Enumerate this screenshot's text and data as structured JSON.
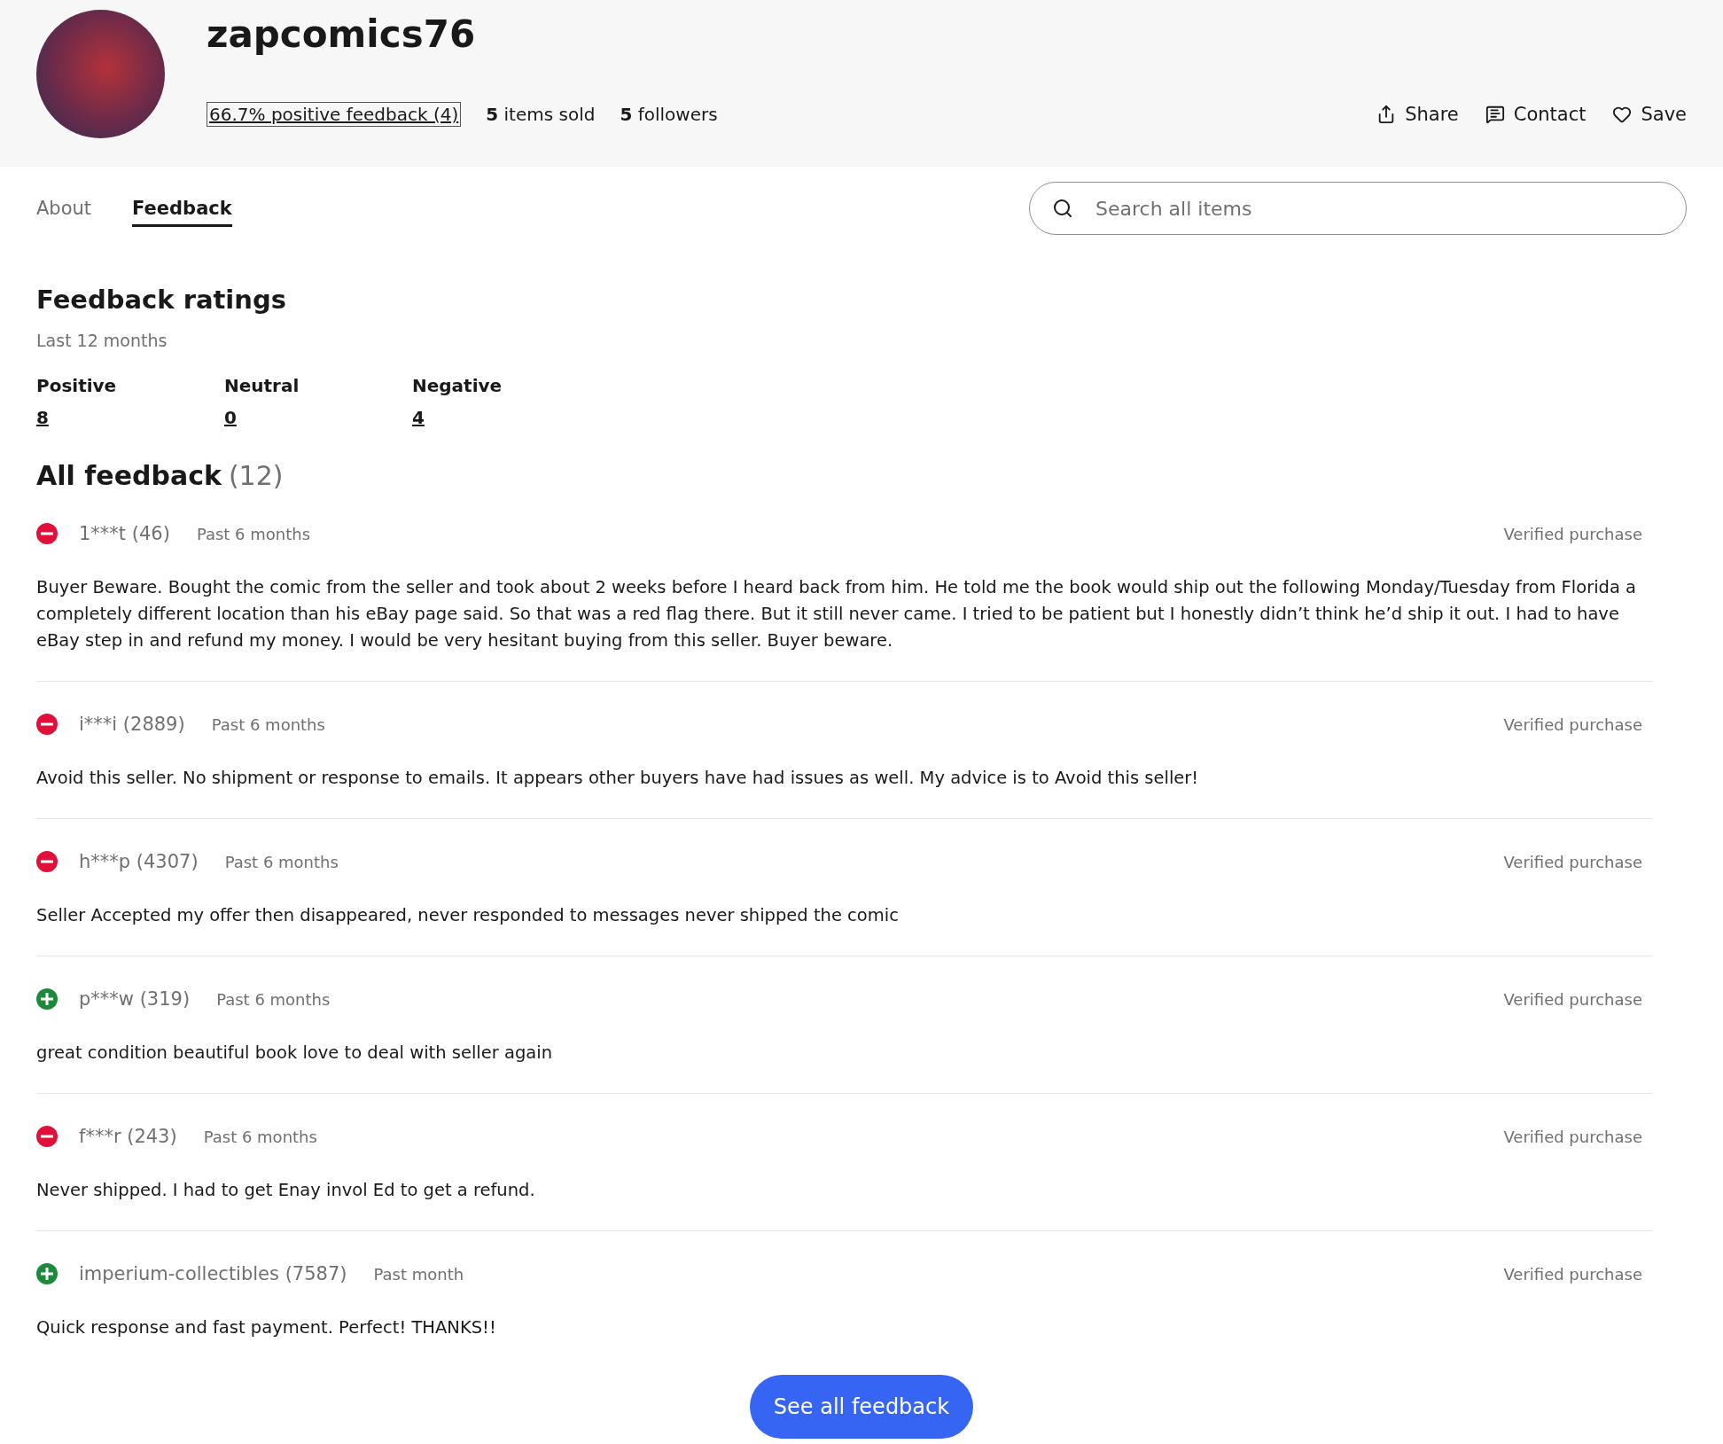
{
  "header": {
    "username": "zapcomics76",
    "feedback_link": "66.7% positive feedback (4)",
    "stats": [
      "**5** items sold",
      "**5** followers"
    ],
    "actions": [
      {
        "kind": "share",
        "label": "Share"
      },
      {
        "kind": "contact",
        "label": "Contact"
      },
      {
        "kind": "save",
        "label": "Save"
      }
    ]
  },
  "tabs": [
    {
      "label": "About",
      "selected": false
    },
    {
      "label": "Feedback",
      "selected": true
    }
  ],
  "search": {
    "placeholder": "Search all items"
  },
  "ratings": {
    "title": "Feedback ratings",
    "period": "Last 12 months",
    "columns": [
      {
        "label": "Positive",
        "count": "8"
      },
      {
        "label": "Neutral",
        "count": "0"
      },
      {
        "label": "Negative",
        "count": "4"
      }
    ]
  },
  "all_feedback": {
    "title": "All feedback",
    "count": "(12)"
  },
  "feedback": [
    {
      "kind": "negative",
      "user": "1***t (46)",
      "time": "Past 6 months",
      "badge": "Verified purchase",
      "text": "Buyer Beware. Bought the comic from the seller and took about 2 weeks before I heard back from him. He told me the book would ship out the following Monday/Tuesday from Florida a completely different location than his eBay page said. So that was a red flag there. But it still never came. I tried to be patient but I honestly didn’t think he’d ship it out. I had to have eBay step in and refund my money. I would be very hesitant buying from this seller. Buyer beware."
    },
    {
      "kind": "negative",
      "user": "i***i (2889)",
      "time": "Past 6 months",
      "badge": "Verified purchase",
      "text": "Avoid this seller. No shipment or response to emails. It appears other buyers have had issues as well. My advice is to Avoid this seller!"
    },
    {
      "kind": "negative",
      "user": "h***p (4307)",
      "time": "Past 6 months",
      "badge": "Verified purchase",
      "text": "Seller Accepted my offer then disappeared, never responded to messages never shipped the comic"
    },
    {
      "kind": "positive",
      "user": "p***w (319)",
      "time": "Past 6 months",
      "badge": "Verified purchase",
      "text": "great condition beautiful book love to deal with seller again"
    },
    {
      "kind": "negative",
      "user": "f***r (243)",
      "time": "Past 6 months",
      "badge": "Verified purchase",
      "text": "Never shipped. I had to get Enay invol Ed to get a refund."
    },
    {
      "kind": "positive",
      "user": "imperium-collectibles (7587)",
      "time": "Past month",
      "badge": "Verified purchase",
      "text": "Quick response and fast payment. Perfect! THANKS!!"
    }
  ],
  "see_all_button": "See all feedback"
}
